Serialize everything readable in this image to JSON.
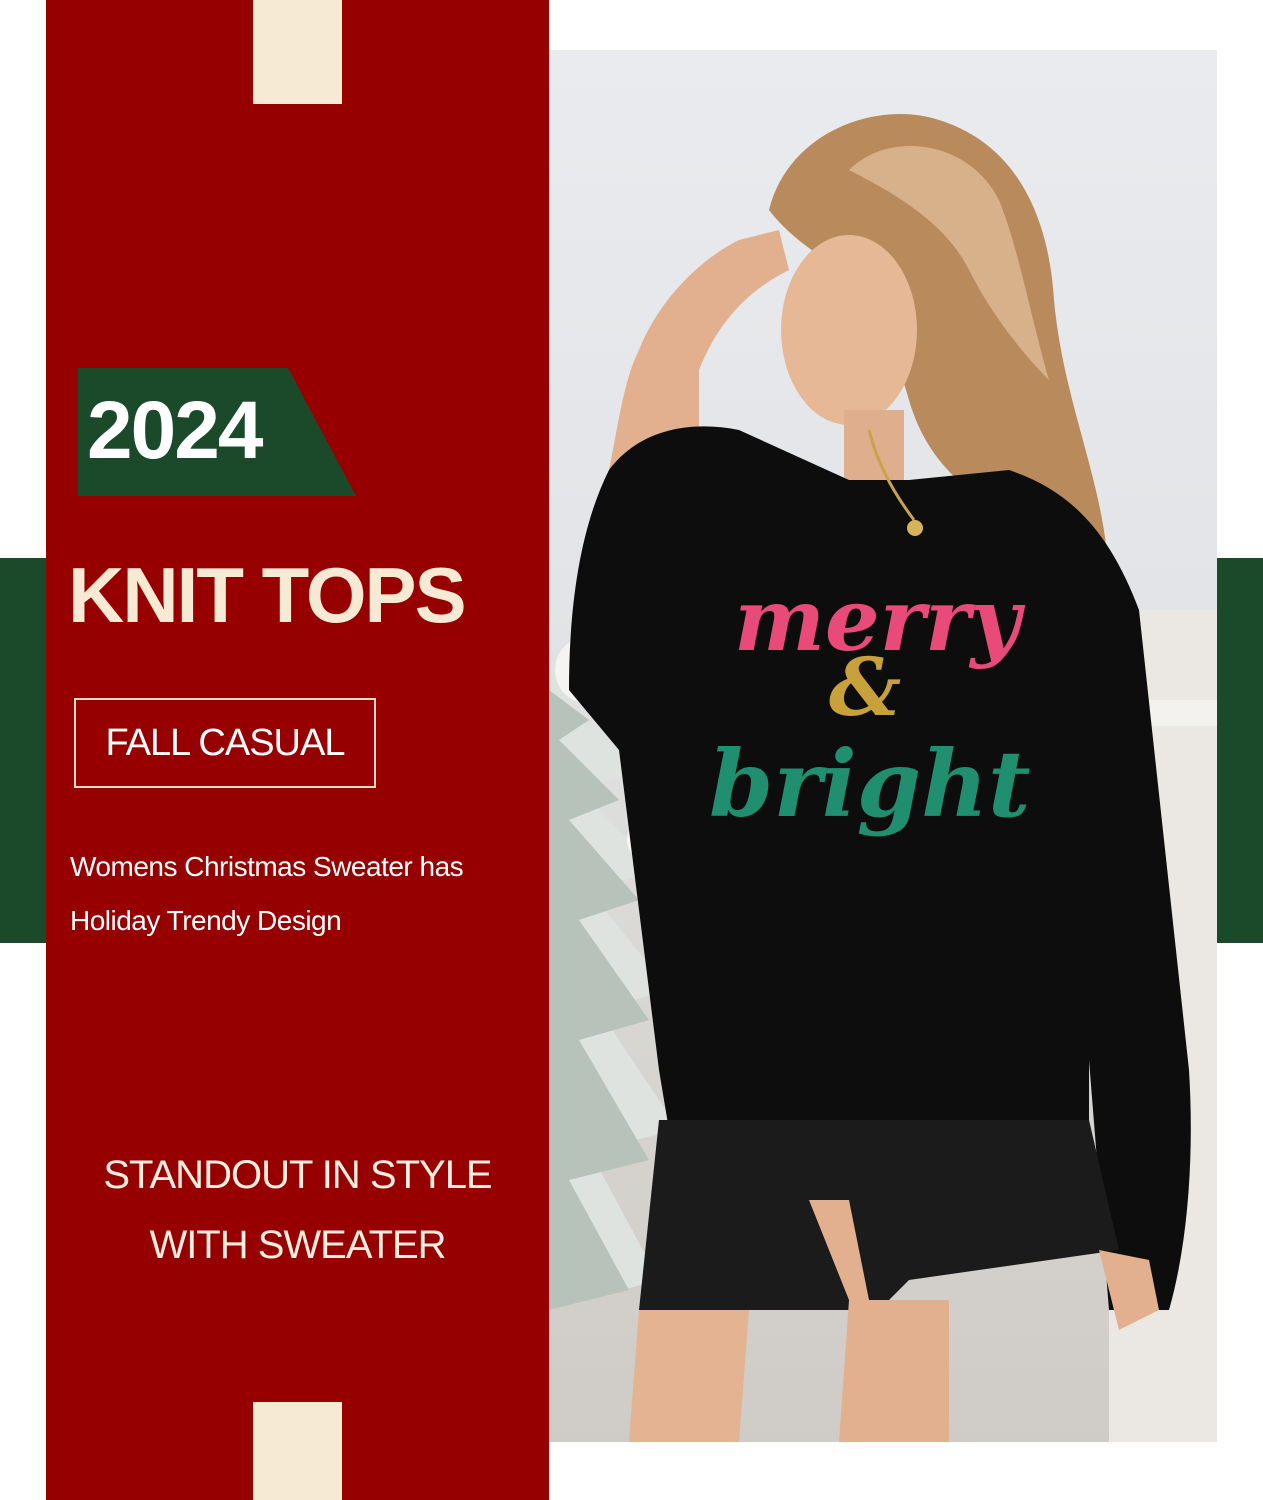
{
  "colors": {
    "red_panel": "#960000",
    "green_accent": "#1a4a2a",
    "cream": "#f6ead4",
    "white": "#ffffff"
  },
  "banner": {
    "year": "2024",
    "headline": "KNIT TOPS",
    "tag": "FALL CASUAL",
    "description_lines": [
      "Womens Christmas Sweater has",
      "Holiday Trendy Design"
    ],
    "slogan_lines": [
      "STANDOUT IN STYLE",
      "WITH SWEATER"
    ]
  },
  "sweater_print": {
    "line1": "merry",
    "line2": "&",
    "line3": "bright"
  }
}
